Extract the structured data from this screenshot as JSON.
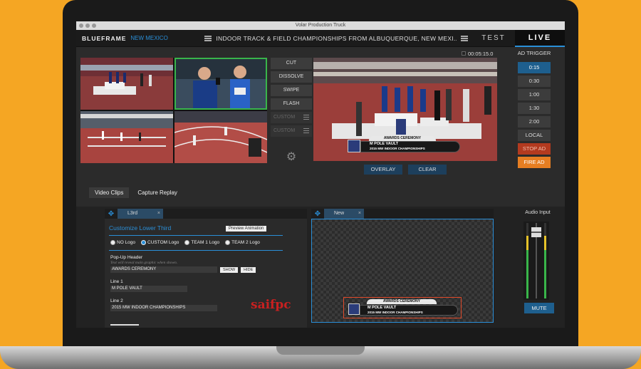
{
  "window": {
    "title": "Volar Production Truck"
  },
  "header": {
    "brand": "BLUEFRAME",
    "region": "NEW MEXICO",
    "event_title": "INDOOR TRACK & FIELD CHAMPIONSHIPS FROM ALBUQUERQUE, NEW MEXI...",
    "test_label": "TEST",
    "live_label": "LIVE"
  },
  "sources": {
    "video_clips": "Video Clips",
    "capture_replay": "Capture Replay"
  },
  "transitions": [
    "CUT",
    "DISSOLVE",
    "SWIPE",
    "FLASH"
  ],
  "custom_slots": [
    "CUSTOM",
    "CUSTOM"
  ],
  "program": {
    "timer": "00:05:15.0",
    "lower_third_top": "AWARDS CEREMONY",
    "lower_third_line1": "M POLE VAULT",
    "lower_third_line2": "2015 MW INDOOR CHAMPIONSHIPS"
  },
  "overlay_buttons": {
    "overlay": "OVERLAY",
    "clear": "CLEAR"
  },
  "ad_trigger": {
    "title": "AD TRIGGER",
    "durations": [
      "0:15",
      "0:30",
      "1:00",
      "1:30",
      "2:00"
    ],
    "active_index": 0,
    "local": "LOCAL",
    "stop": "STOP AD",
    "fire": "FIRE AD"
  },
  "editor": {
    "tab": "L3rd",
    "title": "Customize Lower Third",
    "preview_animation": "Preview Animation",
    "logo_options": [
      "NO Logo",
      "CUSTOM Logo",
      "TEAM 1 Logo",
      "TEAM 2 Logo"
    ],
    "selected_logo_index": 1,
    "popup_header_label": "Pop-Up Header",
    "popup_note": "Text will reveal main graphic when shown.",
    "popup_value": "AWARDS CEREMONY",
    "show": "SHOW",
    "hide": "HIDE",
    "line1_label": "Line 1",
    "line1_value": "M POLE VAULT",
    "line2_label": "Line 2",
    "line2_value": "2015 MW INDOOR CHAMPIONSHIPS"
  },
  "watermark": "saifpc",
  "new_panel": {
    "tab": "New"
  },
  "audio": {
    "title": "Audio Input",
    "mute": "MUTE"
  },
  "colors": {
    "accent": "#2a8fd8",
    "live_green": "#39b54a",
    "stop": "#b33a1f",
    "fire": "#e67e22",
    "background": "#f5a623"
  }
}
